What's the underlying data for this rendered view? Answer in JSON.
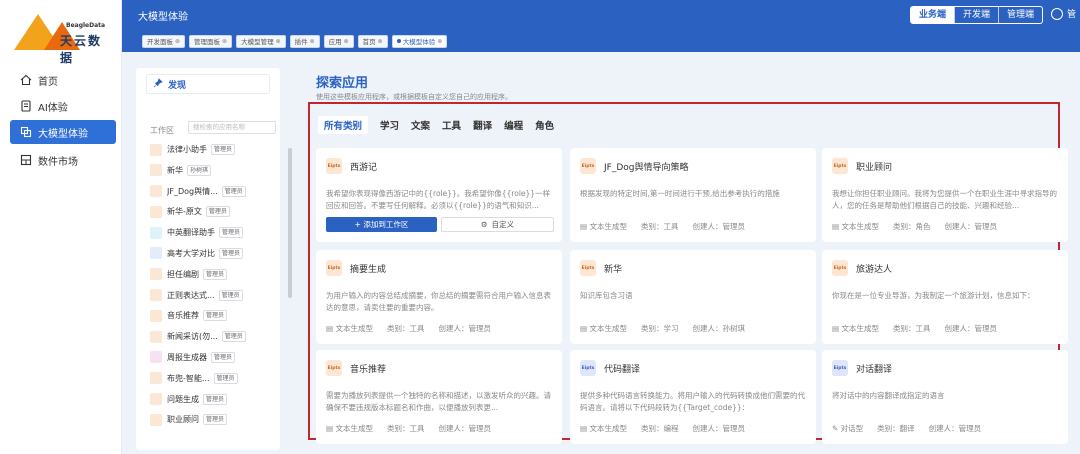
{
  "brand": {
    "logo_en": "BeagleData",
    "logo_cn": "天云数据"
  },
  "nav": {
    "items": [
      {
        "label": "首页"
      },
      {
        "label": "AI体验"
      },
      {
        "label": "大模型体验"
      },
      {
        "label": "数件市场"
      }
    ],
    "active_color": "#2f6fd8"
  },
  "header": {
    "title": "大模型体验",
    "switch": [
      "业务端",
      "开发端",
      "管理端"
    ],
    "user_text": "管"
  },
  "tabs": [
    {
      "label": "开发面板"
    },
    {
      "label": "管理面板"
    },
    {
      "label": "大模型管理"
    },
    {
      "label": "插件"
    },
    {
      "label": "应用"
    },
    {
      "label": "首页"
    },
    {
      "label": "大模型体验"
    }
  ],
  "workspace": {
    "publish_label": "发现",
    "label": "工作区",
    "search_placeholder": "搜检索的应用名称",
    "items": [
      {
        "name": "法律小助手",
        "tag": "管理员"
      },
      {
        "name": "新华",
        "tag": "孙树琪"
      },
      {
        "name": "JF_Dog舆情...",
        "tag": "管理员"
      },
      {
        "name": "新华-原文",
        "tag": "管理员"
      },
      {
        "name": "中英翻译助手",
        "tag": "管理员"
      },
      {
        "name": "高考大学对比",
        "tag": "管理员"
      },
      {
        "name": "担任编剧",
        "tag": "管理员"
      },
      {
        "name": "正则表达式...",
        "tag": "管理员"
      },
      {
        "name": "音乐推荐",
        "tag": "管理员"
      },
      {
        "name": "新闻采访(勿...",
        "tag": "管理员"
      },
      {
        "name": "周报生成器",
        "tag": "管理员"
      },
      {
        "name": "布兜-智能...",
        "tag": "管理员"
      },
      {
        "name": "问题生成",
        "tag": "管理员"
      },
      {
        "name": "职业顾问",
        "tag": "管理员"
      }
    ]
  },
  "explore": {
    "title": "探索应用",
    "subtitle": "使用这些模板应用程序，或根据模板自定义您自己的应用程序。",
    "categories": [
      "所有类别",
      "学习",
      "文案",
      "工具",
      "翻译",
      "编程",
      "角色"
    ],
    "cards": [
      {
        "icon": "Eipts",
        "icon_color": "orange",
        "name": "西游记",
        "desc": "我希望你表现得像西游记中的{{role}}。我希望你像{{role}}一样回应和回答。不要写任何解释。必须以{{role}}的语气和知识...",
        "add_label": "+ 添加到工作区",
        "custom_label": "自定义"
      },
      {
        "icon": "Eipts",
        "icon_color": "orange",
        "name": "JF_Dog舆情导向策略",
        "desc": "根据发现的特定时间,第一时间进行干预,给出参考执行的措施",
        "type": "文本生成型",
        "category": "类别：工具",
        "creator": "创建人：管理员"
      },
      {
        "icon": "Eipts",
        "icon_color": "orange",
        "name": "职业顾问",
        "desc": "我想让你担任职业顾问。我将为您提供一个在职业生涯中寻求指导的人，您的任务是帮助他们根据自己的技能、兴趣和经验...",
        "type": "文本生成型",
        "category": "类别：角色",
        "creator": "创建人：管理员"
      },
      {
        "icon": "Eipts",
        "icon_color": "orange",
        "name": "摘要生成",
        "desc": "为用户输入的内容总结成摘要，你总结的摘要需符合用户输入信息表达的意思，请卖住要的重要内容。",
        "type": "文本生成型",
        "category": "类别：工具",
        "creator": "创建人：管理员"
      },
      {
        "icon": "Eipts",
        "icon_color": "orange",
        "name": "新华",
        "desc": "知识库包含习语",
        "type": "文本生成型",
        "category": "类别：学习",
        "creator": "创建人：孙树琪"
      },
      {
        "icon": "Eipts",
        "icon_color": "orange",
        "name": "旅游达人",
        "desc": "你现在是一位专业导游，为我制定一个旅游计划，信息如下：",
        "type": "文本生成型",
        "category": "类别：工具",
        "creator": "创建人：管理员"
      },
      {
        "icon": "Eipts",
        "icon_color": "orange",
        "name": "音乐推荐",
        "desc": "需要为播放列表提供一个独特的名称和描述，以激发听众的兴趣。请确保不要违规版本标题名和作曲，以便播放列表更...",
        "type": "文本生成型",
        "category": "类别：工具",
        "creator": "创建人：管理员"
      },
      {
        "icon": "Eipts",
        "icon_color": "blue",
        "name": "代码翻译",
        "desc": "提供多种代码语言转换能力。将用户输入的代码转换成他们需要的代码语言。请将以下代码段转为{{Target_code}}：",
        "type": "文本生成型",
        "category": "类别：编程",
        "creator": "创建人：管理员"
      },
      {
        "icon": "Eipts",
        "icon_color": "blue",
        "name": "对话翻译",
        "desc": "将对话中的内容翻译成指定的语言",
        "type": "对话型",
        "category": "类别：翻译",
        "creator": "创建人：管理员"
      }
    ]
  },
  "colors": {
    "header": "#2b62c2",
    "highlight_box": "#c2262e",
    "content_bg": "#eef3fa"
  }
}
